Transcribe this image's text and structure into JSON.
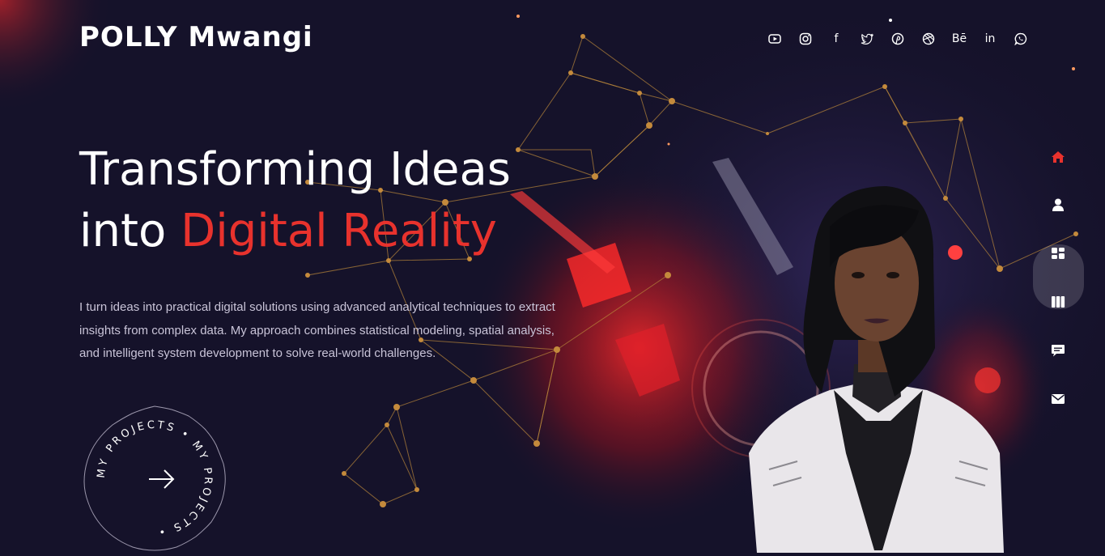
{
  "brand": {
    "name": "POLLY Mwangi"
  },
  "social_links": [
    {
      "icon": "youtube-icon",
      "label": ""
    },
    {
      "icon": "instagram-icon",
      "label": ""
    },
    {
      "icon": "facebook-icon",
      "label": "f"
    },
    {
      "icon": "twitter-icon",
      "label": ""
    },
    {
      "icon": "pinterest-icon",
      "label": ""
    },
    {
      "icon": "dribbble-icon",
      "label": ""
    },
    {
      "icon": "behance-icon",
      "label": "Bē"
    },
    {
      "icon": "linkedin-icon",
      "label": "in"
    },
    {
      "icon": "whatsapp-icon",
      "label": ""
    }
  ],
  "hero": {
    "title_line1": "Transforming Ideas",
    "title_line2_prefix": "into ",
    "title_line2_accent": "Digital Reality",
    "description": "I turn ideas into practical digital solutions using advanced analytical techniques to extract insights from complex data. My approach combines statistical modeling, spatial analysis, and intelligent system development to solve real-world challenges."
  },
  "projects_badge": {
    "text": "MY PROJECTS • MY PROJECTS • "
  },
  "side_nav": [
    {
      "icon": "home-icon",
      "active": true
    },
    {
      "icon": "user-icon",
      "active": false
    },
    {
      "icon": "services-icon",
      "active": false
    },
    {
      "icon": "portfolio-icon",
      "active": false
    },
    {
      "icon": "chat-icon",
      "active": false
    },
    {
      "icon": "mail-icon",
      "active": false
    }
  ],
  "colors": {
    "accent": "#e8322d",
    "background": "#15122a",
    "network": "#b8863a"
  }
}
